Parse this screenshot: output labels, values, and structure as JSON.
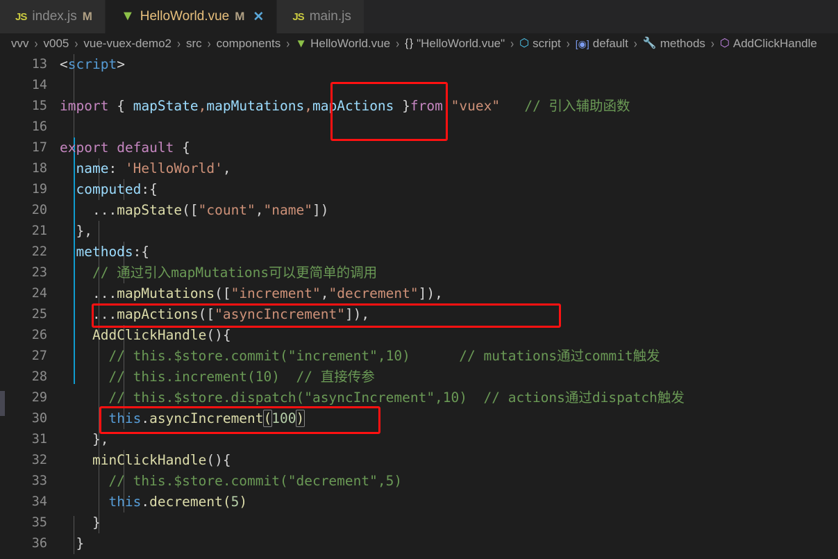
{
  "window": {
    "app": "Visual Studio Code",
    "theme_bg": "#1e1e1e",
    "accent": "#0f9bcf",
    "annotation_color": "#ff1111"
  },
  "tabs": [
    {
      "icon": "javascript-file-icon",
      "icon_label": "JS",
      "label": "index.js",
      "modified_flag": "M",
      "active": false,
      "closable": false
    },
    {
      "icon": "vue-file-icon",
      "icon_label": "V",
      "label": "HelloWorld.vue",
      "modified_flag": "M",
      "active": true,
      "closable": true,
      "close_label": "✕"
    },
    {
      "icon": "javascript-file-icon",
      "icon_label": "JS",
      "label": "main.js",
      "modified_flag": "",
      "active": false,
      "closable": false
    }
  ],
  "breadcrumb": {
    "separator": "›",
    "items": [
      {
        "label": "vvv",
        "icon": ""
      },
      {
        "label": "v005",
        "icon": ""
      },
      {
        "label": "vue-vuex-demo2",
        "icon": ""
      },
      {
        "label": "src",
        "icon": ""
      },
      {
        "label": "components",
        "icon": ""
      },
      {
        "label": "HelloWorld.vue",
        "icon": "vue-file-icon",
        "glyph": "V"
      },
      {
        "label": "\"HelloWorld.vue\"",
        "icon": "object-symbol-icon",
        "glyph": "{ }"
      },
      {
        "label": "script",
        "icon": "module-symbol-icon",
        "glyph": "⬡"
      },
      {
        "label": "default",
        "icon": "variable-symbol-icon",
        "glyph": "[⊙]"
      },
      {
        "label": "methods",
        "icon": "property-symbol-icon",
        "glyph": "ὒ7"
      },
      {
        "label": "AddClickHandle",
        "icon": "method-symbol-icon",
        "glyph": "⬡"
      }
    ]
  },
  "editor": {
    "first_line_number": 13,
    "last_line_number": 36,
    "language": "vue",
    "lines": [
      {
        "n": 13,
        "text": "<script>"
      },
      {
        "n": 14,
        "text": ""
      },
      {
        "n": 15,
        "text": "import { mapState,mapMutations,mapActions } from \"vuex\"   // 引入辅助函数"
      },
      {
        "n": 16,
        "text": ""
      },
      {
        "n": 17,
        "text": "export default {"
      },
      {
        "n": 18,
        "text": "  name: 'HelloWorld',"
      },
      {
        "n": 19,
        "text": "  computed:{"
      },
      {
        "n": 20,
        "text": "    ...mapState([\"count\",\"name\"])"
      },
      {
        "n": 21,
        "text": "  },"
      },
      {
        "n": 22,
        "text": "  methods:{"
      },
      {
        "n": 23,
        "text": "    // 通过引入mapMutations可以更简单的调用"
      },
      {
        "n": 24,
        "text": "    ...mapMutations([\"increment\",\"decrement\"]),"
      },
      {
        "n": 25,
        "text": "    ...mapActions([\"asyncIncrement\"]),"
      },
      {
        "n": 26,
        "text": "    AddClickHandle(){"
      },
      {
        "n": 27,
        "text": "      // this.$store.commit(\"increment\",10)      // mutations通过commit触发"
      },
      {
        "n": 28,
        "text": "      // this.increment(10)  // 直接传参"
      },
      {
        "n": 29,
        "text": "      // this.$store.dispatch(\"asyncIncrement\",10)  // actions通过dispatch触发"
      },
      {
        "n": 30,
        "text": "      this.asyncIncrement(100)"
      },
      {
        "n": 31,
        "text": "    },"
      },
      {
        "n": 32,
        "text": "    minClickHandle(){"
      },
      {
        "n": 33,
        "text": "      // this.$store.commit(\"decrement\",5)"
      },
      {
        "n": 34,
        "text": "      this.decrement(5)"
      },
      {
        "n": 35,
        "text": "    }"
      },
      {
        "n": 36,
        "text": "  }"
      }
    ]
  },
  "annotations": [
    {
      "name": "highlight-mapactions-import",
      "target_line": 15,
      "label": "mapActions }"
    },
    {
      "name": "highlight-mapactions-spread",
      "target_line": 25,
      "label": "...mapActions([\"asyncIncrement\"]),"
    },
    {
      "name": "highlight-asyncincrement-call",
      "target_line": 30,
      "label": "this.asyncIncrement(100)"
    }
  ],
  "code_tokens": {
    "l13": {
      "t1": "<",
      "t2": "script",
      "t3": ">"
    },
    "l15": {
      "kw_import": "import",
      "b1": "{",
      "v1": "mapState",
      "c1": ",",
      "v2": "mapMutations",
      "c2": ",",
      "v3": "mapActions",
      "b2": "}",
      "kw_from": "from",
      "mod": "\"vuex\"",
      "comment": "// 引入辅助函数"
    },
    "l17": {
      "kw1": "export",
      "kw2": "default",
      "b": "{"
    },
    "l18": {
      "key": "name",
      "colon": ": ",
      "val": "'HelloWorld'",
      "comma": ","
    },
    "l19": {
      "key": "computed",
      "rest": ":{"
    },
    "l20": {
      "spread": "...",
      "fn": "mapState",
      "open": "([",
      "s1": "\"count\"",
      "c": ",",
      "s2": "\"name\"",
      "close": "])"
    },
    "l21": {
      "t": "},"
    },
    "l22": {
      "key": "methods",
      "rest": ":{"
    },
    "l23": {
      "comment": "// 通过引入mapMutations可以更简单的调用"
    },
    "l24": {
      "spread": "...",
      "fn": "mapMutations",
      "open": "([",
      "s1": "\"increment\"",
      "c": ",",
      "s2": "\"decrement\"",
      "close": "]),"
    },
    "l25": {
      "spread": "...",
      "fn": "mapActions",
      "open": "([",
      "s1": "\"asyncIncrement\"",
      "close": "]),"
    },
    "l26": {
      "fn": "AddClickHandle",
      "rest": "(){"
    },
    "l27": {
      "comment": "// this.$store.commit(\"increment\",10)",
      "comment2": "// mutations通过commit触发"
    },
    "l28": {
      "comment": "// this.increment(10)",
      "comment2": "// 直接传参"
    },
    "l29": {
      "comment": "// this.$store.dispatch(\"asyncIncrement\",10)",
      "comment2": "// actions通过dispatch触发"
    },
    "l30": {
      "kw_this": "this",
      "dot": ".",
      "fn": "asyncIncrement",
      "open": "(",
      "num": "100",
      "close": ")"
    },
    "l31": {
      "t": "},"
    },
    "l32": {
      "fn": "minClickHandle",
      "rest": "(){"
    },
    "l33": {
      "comment": "// this.$store.commit(\"decrement\",5)"
    },
    "l34": {
      "kw_this": "this",
      "dot": ".",
      "fn": "decrement",
      "open": "(",
      "num": "5",
      "close": ")"
    },
    "l35": {
      "t": "}"
    },
    "l36": {
      "t": "}"
    }
  }
}
